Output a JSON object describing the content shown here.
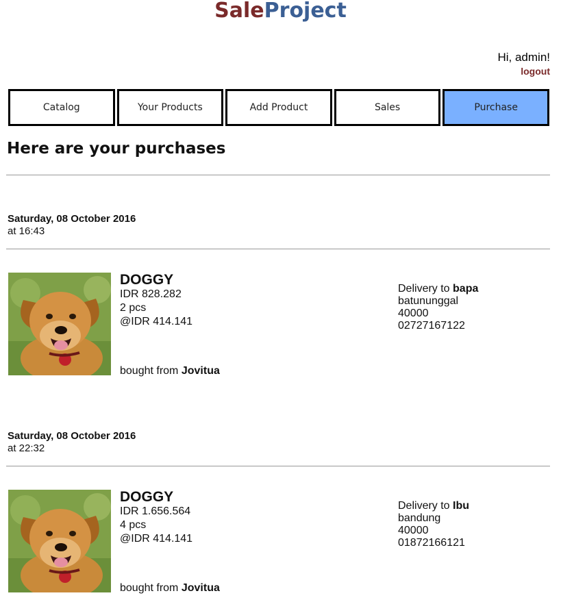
{
  "brand": {
    "part1": "Sale",
    "part2": "Project"
  },
  "user": {
    "greeting": "Hi, admin!",
    "logout_label": "logout"
  },
  "nav": {
    "items": [
      {
        "label": "Catalog",
        "active": false
      },
      {
        "label": "Your Products",
        "active": false
      },
      {
        "label": "Add Product",
        "active": false
      },
      {
        "label": "Sales",
        "active": false
      },
      {
        "label": "Purchase",
        "active": true
      }
    ],
    "active_color": "#7ab0ff"
  },
  "page_title": "Here are your purchases",
  "purchases": [
    {
      "date": "Saturday, 08 October 2016",
      "time": "at 16:43",
      "product_name": "DOGGY",
      "total": "IDR 828.282",
      "quantity": "2 pcs",
      "unit_price": "@IDR 414.141",
      "bought_from_prefix": "bought from",
      "seller": "Jovitua",
      "delivery_prefix": "Delivery to",
      "recipient": "bapa",
      "address": "batununggal",
      "postal_code": "40000",
      "phone": "02727167122",
      "image": "dog-photo"
    },
    {
      "date": "Saturday, 08 October 2016",
      "time": "at 22:32",
      "product_name": "DOGGY",
      "total": "IDR 1.656.564",
      "quantity": "4 pcs",
      "unit_price": "@IDR 414.141",
      "bought_from_prefix": "bought from",
      "seller": "Jovitua",
      "delivery_prefix": "Delivery to",
      "recipient": "Ibu",
      "address": "bandung",
      "postal_code": "40000",
      "phone": "01872166121",
      "image": "dog-photo"
    }
  ]
}
